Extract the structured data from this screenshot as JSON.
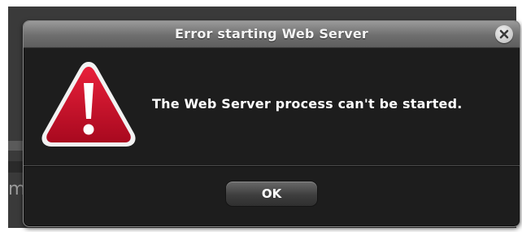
{
  "dialog": {
    "title": "Error starting Web Server",
    "message": "The Web Server process can't be started.",
    "ok_label": "OK",
    "icons": {
      "alert": "warning-icon",
      "close": "close-icon"
    },
    "colors": {
      "dialog_bg": "#1d1d1d",
      "titlebar": "#7a7a7a",
      "warning_red": "#c4102a",
      "text": "#ffffff"
    }
  },
  "background": {
    "partial_glyph": "m"
  }
}
